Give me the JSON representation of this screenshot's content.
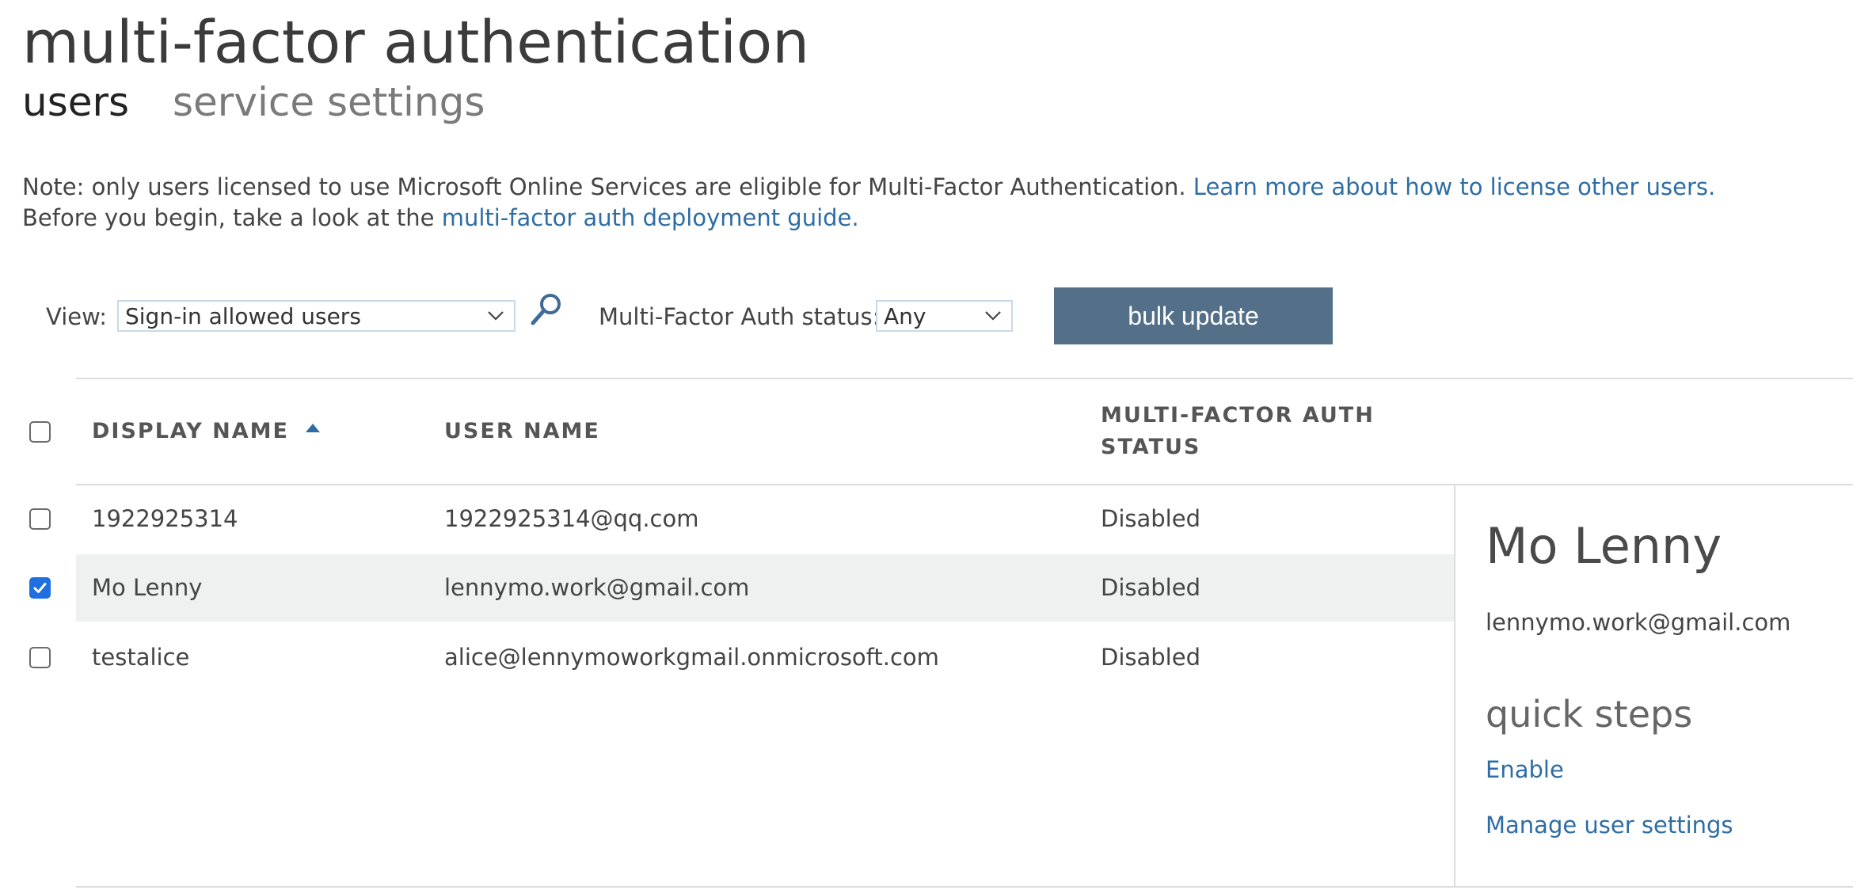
{
  "header": {
    "title": "multi-factor authentication",
    "tabs": [
      {
        "label": "users",
        "active": true
      },
      {
        "label": "service settings",
        "active": false
      }
    ]
  },
  "notes": {
    "line1_text": "Note: only users licensed to use Microsoft Online Services are eligible for Multi-Factor Authentication. ",
    "line1_link": "Learn more about how to license other users.",
    "line2_text": "Before you begin, take a look at the ",
    "line2_link": "multi-factor auth deployment guide."
  },
  "toolbar": {
    "view_label": "View:",
    "view_selected": "Sign-in allowed users",
    "status_label": "Multi-Factor Auth status:",
    "status_selected": "Any",
    "bulk_update_label": "bulk update"
  },
  "table": {
    "columns": {
      "display_name": "DISPLAY NAME",
      "user_name": "USER NAME",
      "mfa_status_line1": "MULTI-FACTOR AUTH",
      "mfa_status_line2": "STATUS"
    },
    "sort": {
      "column": "display_name",
      "direction": "ascending"
    },
    "rows": [
      {
        "display_name": "1922925314",
        "user_name": "1922925314@qq.com",
        "status": "Disabled",
        "checked": false
      },
      {
        "display_name": "Mo Lenny",
        "user_name": "lennymo.work@gmail.com",
        "status": "Disabled",
        "checked": true
      },
      {
        "display_name": "testalice",
        "user_name": "alice@lennymoworkgmail.onmicrosoft.com",
        "status": "Disabled",
        "checked": false
      }
    ]
  },
  "detail": {
    "name": "Mo Lenny",
    "email": "lennymo.work@gmail.com",
    "quick_steps_title": "quick steps",
    "actions": [
      {
        "label": "Enable"
      },
      {
        "label": "Manage user settings"
      }
    ]
  },
  "colors": {
    "link": "#2e6da4",
    "button_bg": "#547089",
    "checkbox_checked": "#1f6fe0",
    "selected_row_bg": "#eff1f0"
  },
  "icons": {
    "search": "search-icon",
    "dropdown": "chevron-down-icon",
    "sort": "sort-ascending-icon",
    "check": "checkmark-icon"
  }
}
